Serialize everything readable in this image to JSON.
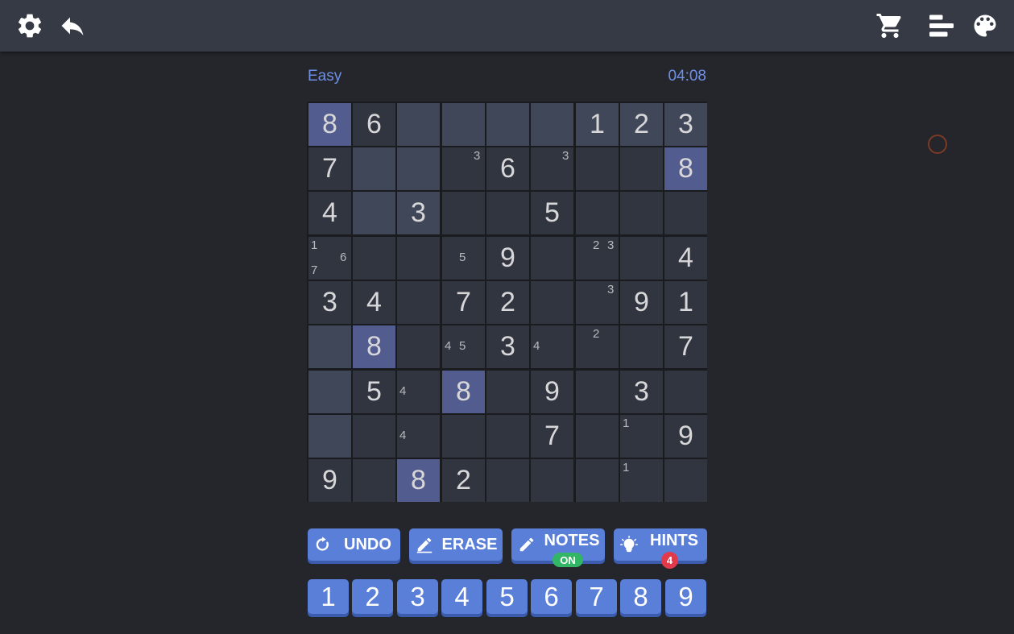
{
  "header": {
    "icons_left": [
      "settings-icon",
      "back-arrow-icon"
    ],
    "icons_right": [
      "cart-icon",
      "leaderboard-icon",
      "palette-icon"
    ]
  },
  "game": {
    "difficulty": "Easy",
    "timer": "04:08"
  },
  "colors": {
    "cell_bg": "#31353f",
    "cell_shaded": "#404758",
    "cell_selected": "#535c8e",
    "accent": "#5a7fd9"
  },
  "board": {
    "values": [
      [
        "8",
        "6",
        "",
        "",
        "",
        "",
        "1",
        "2",
        "3"
      ],
      [
        "7",
        "",
        "",
        "",
        "6",
        "",
        "",
        "",
        "8"
      ],
      [
        "4",
        "",
        "3",
        "",
        "",
        "5",
        "",
        "",
        ""
      ],
      [
        "",
        "",
        "",
        "",
        "9",
        "",
        "",
        "",
        "4"
      ],
      [
        "3",
        "4",
        "",
        "7",
        "2",
        "",
        "",
        "9",
        "1"
      ],
      [
        "",
        "8",
        "",
        "",
        "3",
        "",
        "",
        "",
        "7"
      ],
      [
        "",
        "5",
        "",
        "8",
        "",
        "9",
        "",
        "3",
        ""
      ],
      [
        "",
        "",
        "",
        "",
        "",
        "7",
        "",
        "",
        "9"
      ],
      [
        "9",
        "",
        "8",
        "2",
        "",
        "",
        "",
        "",
        ""
      ]
    ],
    "notes": [
      [
        [],
        [],
        [],
        [],
        [],
        [],
        [],
        [],
        []
      ],
      [
        [],
        [],
        [],
        [
          3
        ],
        [],
        [
          3
        ],
        [],
        [],
        []
      ],
      [
        [],
        [],
        [],
        [],
        [],
        [],
        [],
        [],
        []
      ],
      [
        [
          1,
          6,
          7
        ],
        [],
        [],
        [
          5
        ],
        [],
        [],
        [
          2,
          3
        ],
        [],
        []
      ],
      [
        [],
        [],
        [],
        [],
        [],
        [],
        [
          3
        ],
        [],
        []
      ],
      [
        [],
        [],
        [],
        [
          4,
          5
        ],
        [],
        [
          4
        ],
        [
          2
        ],
        [],
        []
      ],
      [
        [],
        [],
        [
          4
        ],
        [],
        [],
        [],
        [],
        [],
        []
      ],
      [
        [],
        [],
        [
          4
        ],
        [],
        [],
        [],
        [],
        [
          1
        ],
        []
      ],
      [
        [],
        [],
        [],
        [],
        [],
        [],
        [],
        [
          1
        ],
        []
      ]
    ],
    "shaded": [
      [
        0,
        0,
        1,
        1,
        1,
        1,
        1,
        1,
        1
      ],
      [
        0,
        1,
        1,
        0,
        0,
        0,
        0,
        0,
        0
      ],
      [
        0,
        1,
        1,
        0,
        0,
        0,
        0,
        0,
        0
      ],
      [
        0,
        0,
        0,
        0,
        0,
        0,
        0,
        0,
        0
      ],
      [
        0,
        0,
        0,
        0,
        0,
        0,
        0,
        0,
        0
      ],
      [
        1,
        0,
        0,
        0,
        0,
        0,
        0,
        0,
        0
      ],
      [
        1,
        0,
        0,
        0,
        0,
        0,
        0,
        0,
        0
      ],
      [
        1,
        0,
        0,
        0,
        0,
        0,
        0,
        0,
        0
      ],
      [
        0,
        0,
        0,
        0,
        0,
        0,
        0,
        0,
        0
      ]
    ],
    "selected": [
      [
        1,
        0,
        0,
        0,
        0,
        0,
        0,
        0,
        0
      ],
      [
        0,
        0,
        0,
        0,
        0,
        0,
        0,
        0,
        1
      ],
      [
        0,
        0,
        0,
        0,
        0,
        0,
        0,
        0,
        0
      ],
      [
        0,
        0,
        0,
        0,
        0,
        0,
        0,
        0,
        0
      ],
      [
        0,
        0,
        0,
        0,
        0,
        0,
        0,
        0,
        0
      ],
      [
        0,
        1,
        0,
        0,
        0,
        0,
        0,
        0,
        0
      ],
      [
        0,
        0,
        0,
        1,
        0,
        0,
        0,
        0,
        0
      ],
      [
        0,
        0,
        0,
        0,
        0,
        0,
        0,
        0,
        0
      ],
      [
        0,
        0,
        1,
        0,
        0,
        0,
        0,
        0,
        0
      ]
    ]
  },
  "actions": {
    "undo": {
      "label": "UNDO",
      "icon": "undo-icon"
    },
    "erase": {
      "label": "ERASE",
      "icon": "erase-icon"
    },
    "notes": {
      "label": "NOTES",
      "icon": "pencil-icon",
      "status": "ON"
    },
    "hints": {
      "label": "HINTS",
      "icon": "bulb-icon",
      "count": "4"
    }
  },
  "numpad": [
    "1",
    "2",
    "3",
    "4",
    "5",
    "6",
    "7",
    "8",
    "9"
  ]
}
